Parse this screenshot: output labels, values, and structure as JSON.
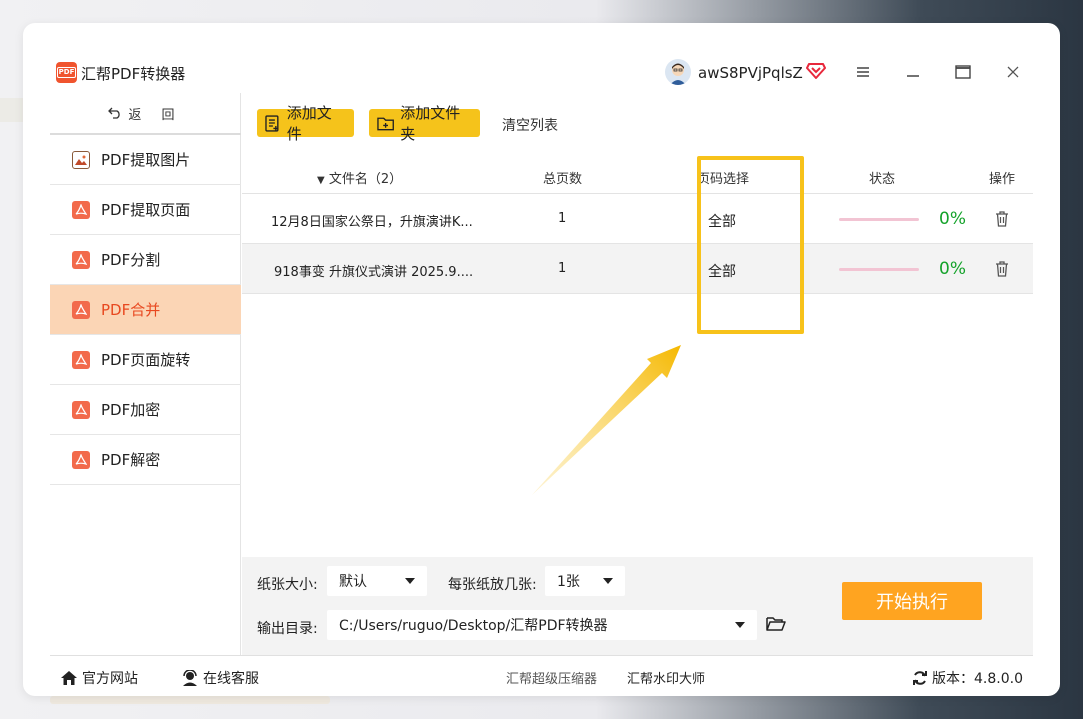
{
  "app": {
    "title": "汇帮PDF转换器",
    "logo_text": "PDF"
  },
  "user": {
    "name": "awS8PVjPqlsZ"
  },
  "sidebar": {
    "back_label": "返 回",
    "items": [
      {
        "label": "PDF提取图片",
        "icon": "image-icon"
      },
      {
        "label": "PDF提取页面",
        "icon": "pdf-icon"
      },
      {
        "label": "PDF分割",
        "icon": "pdf-icon"
      },
      {
        "label": "PDF合并",
        "icon": "pdf-icon",
        "active": true
      },
      {
        "label": "PDF页面旋转",
        "icon": "pdf-icon"
      },
      {
        "label": "PDF加密",
        "icon": "pdf-icon"
      },
      {
        "label": "PDF解密",
        "icon": "pdf-icon"
      }
    ]
  },
  "toolbar": {
    "add_file": "添加文件",
    "add_folder": "添加文件夹",
    "clear_list": "清空列表"
  },
  "table": {
    "headers": {
      "filename": "文件名（2）",
      "pages": "总页数",
      "page_select": "页码选择",
      "status": "状态",
      "action": "操作"
    },
    "rows": [
      {
        "filename": "12月8日国家公祭日，升旗演讲K...",
        "pages": "1",
        "page_select": "全部",
        "progress": "0%"
      },
      {
        "filename": "918事变 升旗仪式演讲 2025.9....",
        "pages": "1",
        "page_select": "全部",
        "progress": "0%"
      }
    ]
  },
  "settings": {
    "paper_size_label": "纸张大小:",
    "paper_size_value": "默认",
    "per_sheet_label": "每张纸放几张:",
    "per_sheet_value": "1张",
    "output_label": "输出目录:",
    "output_path": "C:/Users/ruguo/Desktop/汇帮PDF转换器",
    "start_button": "开始执行"
  },
  "footer": {
    "website": "官方网站",
    "support": "在线客服",
    "link1": "汇帮超级压缩器",
    "link2": "汇帮水印大师",
    "version_label": "版本：4.8.0.0"
  },
  "colors": {
    "accent": "#f5c31b",
    "active_nav_bg": "#fbd5b5",
    "active_nav_text": "#e8481f",
    "start_button": "#ffa420",
    "progress_text": "#14a22a",
    "highlight": "#f7c21a"
  }
}
